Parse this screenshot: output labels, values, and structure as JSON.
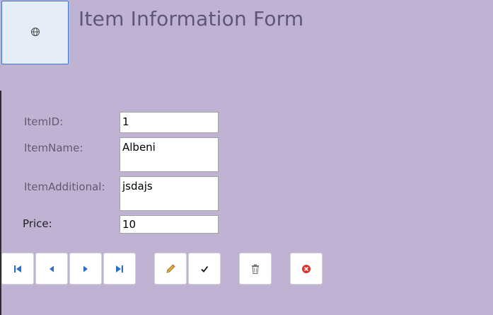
{
  "header": {
    "title": "Item Information Form",
    "logo_icon": "globe-icon"
  },
  "form": {
    "fields": [
      {
        "label": "ItemID:",
        "value": "1"
      },
      {
        "label": "ItemName:",
        "value": "Albeni"
      },
      {
        "label": "ItemAdditional:",
        "value": "jsdajs"
      },
      {
        "label": "Price:",
        "value": "10"
      }
    ]
  },
  "toolbar": {
    "buttons": [
      {
        "icon": "first-record-icon"
      },
      {
        "icon": "previous-record-icon"
      },
      {
        "icon": "next-record-icon"
      },
      {
        "icon": "last-record-icon"
      },
      {
        "icon": "pencil-icon"
      },
      {
        "icon": "checkmark-icon"
      },
      {
        "icon": "trash-icon"
      },
      {
        "icon": "close-circle-icon"
      }
    ]
  },
  "colors": {
    "background": "#c0b2d2",
    "title": "#5d5775",
    "nav_blue": "#2f6fc1",
    "close_red": "#d9342b"
  }
}
